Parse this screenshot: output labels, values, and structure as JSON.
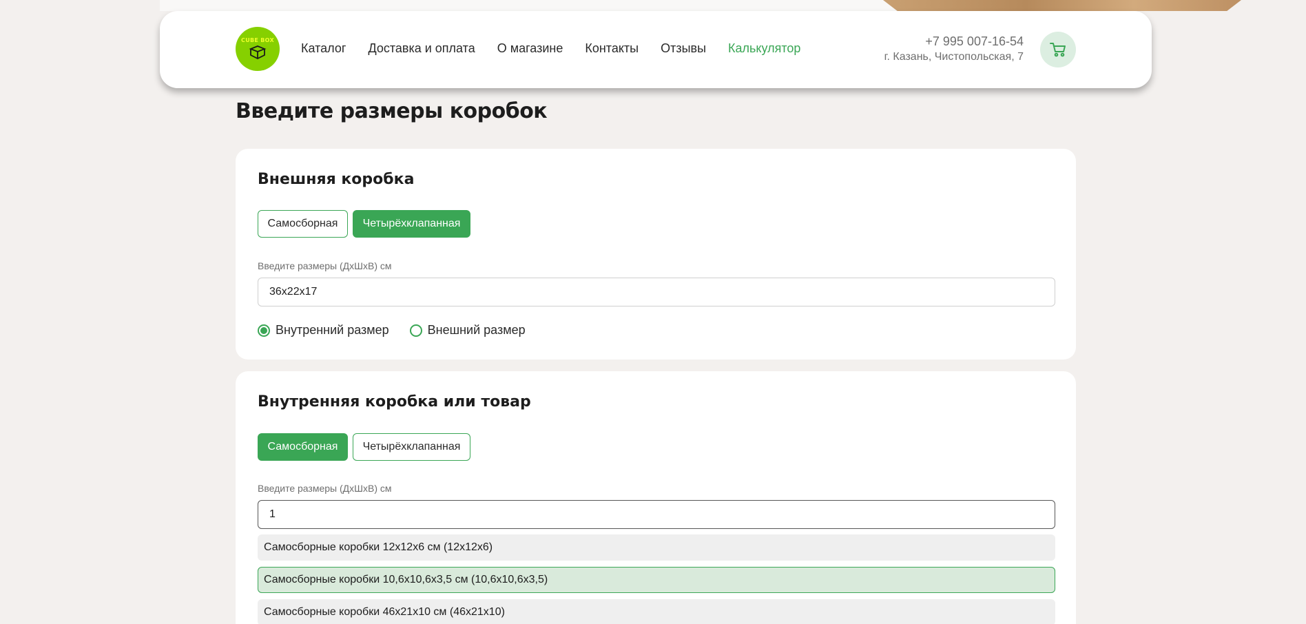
{
  "header": {
    "logo_text": "CUBE BOX",
    "nav": [
      {
        "label": "Каталог"
      },
      {
        "label": "Доставка и оплата"
      },
      {
        "label": "О магазине"
      },
      {
        "label": "Контакты"
      },
      {
        "label": "Отзывы"
      },
      {
        "label": "Калькулятор",
        "active": true
      }
    ],
    "phone": "+7 995 007-16-54",
    "address": "г. Казань, Чистопольская, 7",
    "cart_icon": "cart-icon"
  },
  "page": {
    "title": "Введите размеры коробок"
  },
  "outer_box": {
    "title": "Внешняя коробка",
    "type_options": [
      "Самосборная",
      "Четырёхклапанная"
    ],
    "selected_type": "Четырёхклапанная",
    "size_label": "Введите размеры (ДхШхВ) см",
    "size_value": "36x22x17",
    "measure_options": [
      "Внутренний размер",
      "Внешний размер"
    ],
    "selected_measure": "Внутренний размер"
  },
  "inner_box": {
    "title": "Внутренняя коробка или товар",
    "type_options": [
      "Самосборная",
      "Четырёхклапанная"
    ],
    "selected_type": "Самосборная",
    "size_label": "Введите размеры (ДхШхВ) см",
    "size_value": "1",
    "suggestions": [
      "Самосборные коробки 12x12x6 см (12x12x6)",
      "Самосборные коробки 10,6x10,6x3,5 см (10,6x10,6x3,5)",
      "Самосборные коробки 46x21x10 см (46x21x10)"
    ],
    "highlighted_suggestion": 1
  },
  "colors": {
    "accent": "#3aa655",
    "logo": "#86d000",
    "background": "#f3f0ee"
  }
}
